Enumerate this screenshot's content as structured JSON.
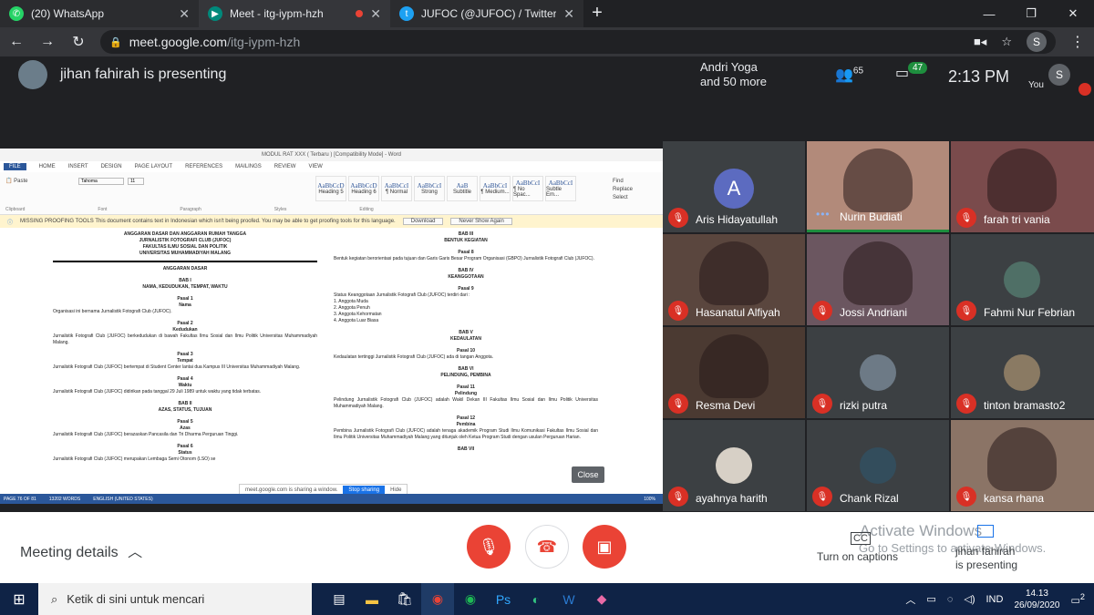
{
  "browser": {
    "tabs": [
      {
        "title": "(20) WhatsApp",
        "icon": "whatsapp-icon",
        "color": "#25d366"
      },
      {
        "title": "Meet - itg-iypm-hzh",
        "icon": "meet-icon",
        "color": "#00897b"
      },
      {
        "title": "JUFOC (@JUFOC) / Twitter",
        "icon": "twitter-icon",
        "color": "#1da1f2"
      }
    ],
    "url_host": "meet.google.com",
    "url_path": "/itg-iypm-hzh",
    "profile_initial": "S"
  },
  "meet": {
    "presenting_text": "jihan fahirah is presenting",
    "others_line1": "Andri Yoga",
    "others_line2": "and 50 more",
    "people_count": "65",
    "chat_count": "47",
    "time": "2:13 PM",
    "you_label": "You",
    "you_initial": "S"
  },
  "word": {
    "title": "MODUL RAT XXX ( Terbaru ) [Compatibility Mode] - Word",
    "ribbon_tabs": [
      "FILE",
      "HOME",
      "INSERT",
      "DESIGN",
      "PAGE LAYOUT",
      "REFERENCES",
      "MAILINGS",
      "REVIEW",
      "VIEW"
    ],
    "styles": [
      {
        "preview": "AaBbCcD",
        "name": "Heading 5"
      },
      {
        "preview": "AaBbCcD",
        "name": "Heading 6"
      },
      {
        "preview": "AaBbCcI",
        "name": "¶ Normal"
      },
      {
        "preview": "AaBbCcI",
        "name": "Strong"
      },
      {
        "preview": "AaB",
        "name": "Subtitle"
      },
      {
        "preview": "AaBbCcI",
        "name": "¶ Medium..."
      },
      {
        "preview": "AaBbCcI",
        "name": "¶ No Spac..."
      },
      {
        "preview": "AaBbCcI",
        "name": "Subtle Em..."
      }
    ],
    "ribbon_groups": [
      "Clipboard",
      "Font",
      "Paragraph",
      "Styles",
      "Editing"
    ],
    "proofing_msg": "MISSING PROOFING TOOLS   This document contains text in Indonesian which isn't being proofed. You may be able to get proofing tools for this language.",
    "proofing_download": "Download",
    "proofing_never": "Never Show Again",
    "col1": [
      {
        "t": "h",
        "v": "ANGGARAN DASAR DAN ANGGARAN RUMAH TANGGA"
      },
      {
        "t": "h",
        "v": "JURNALISTIK FOTOGRAFI CLUB (JUFOC)"
      },
      {
        "t": "h",
        "v": "FAKULTAS ILMU SOSIAL DAN POLITIK"
      },
      {
        "t": "h",
        "v": "UNIVERSITAS MUHAMMADIYAH MALANG"
      },
      {
        "t": "hr",
        "v": ""
      },
      {
        "t": "h",
        "v": "ANGGARAN DASAR"
      },
      {
        "t": "s",
        "v": ""
      },
      {
        "t": "h",
        "v": "BAB I"
      },
      {
        "t": "h",
        "v": "NAMA, KEDUDUKAN, TEMPAT, WAKTU"
      },
      {
        "t": "s",
        "v": ""
      },
      {
        "t": "h",
        "v": "Pasal 1"
      },
      {
        "t": "h",
        "v": "Nama"
      },
      {
        "t": "p",
        "v": "Organisasi ini bernama Jurnalistik Fotografi Club (JUFOC)."
      },
      {
        "t": "s",
        "v": ""
      },
      {
        "t": "h",
        "v": "Pasal 2"
      },
      {
        "t": "h",
        "v": "Kedudukan"
      },
      {
        "t": "p",
        "v": "Jurnalistik Fotografi Club (JUFOC) berkedudukan di bawah Fakultas Ilmu Sosial dan Ilmu Politik Universitas Muhammadiyah Malang."
      },
      {
        "t": "s",
        "v": ""
      },
      {
        "t": "h",
        "v": "Pasal 3"
      },
      {
        "t": "h",
        "v": "Tempat"
      },
      {
        "t": "p",
        "v": "Jurnalistik Fotografi Club (JUFOC) bertempat di Student Center lantai dua Kampus III Universitas Muhammadiyah Malang."
      },
      {
        "t": "s",
        "v": ""
      },
      {
        "t": "h",
        "v": "Pasal 4"
      },
      {
        "t": "h",
        "v": "Waktu"
      },
      {
        "t": "p",
        "v": "Jurnalistik Fotografi Club (JUFOC) didirikan pada tanggal 29 Juli 1989 untuk waktu yang tidak terbatas."
      },
      {
        "t": "s",
        "v": ""
      },
      {
        "t": "h",
        "v": "BAB II"
      },
      {
        "t": "h",
        "v": "AZAS, STATUS, TUJUAN"
      },
      {
        "t": "s",
        "v": ""
      },
      {
        "t": "h",
        "v": "Pasal 5"
      },
      {
        "t": "h",
        "v": "Azas"
      },
      {
        "t": "p",
        "v": "Jurnalistik Fotografi Club (JUFOC) berazaskan Pancasila dan Tri Dharma Perguruan Tinggi."
      },
      {
        "t": "s",
        "v": ""
      },
      {
        "t": "h",
        "v": "Pasal 6"
      },
      {
        "t": "h",
        "v": "Status"
      },
      {
        "t": "p",
        "v": "Jurnalistik Fotografi Club (JUFOC) merupakan Lembaga Semi Otonom (LSO) se"
      }
    ],
    "col2": [
      {
        "t": "h",
        "v": "BAB III"
      },
      {
        "t": "h",
        "v": "BENTUK KEGIATAN"
      },
      {
        "t": "s",
        "v": ""
      },
      {
        "t": "h",
        "v": "Pasal 8"
      },
      {
        "t": "p",
        "v": "Bentuk kegiatan berorientasi pada tujuan dan Garis Garis Besar Program Organisasi (GBPO) Jurnalistik Fotografi Club (JUFOC)."
      },
      {
        "t": "s",
        "v": ""
      },
      {
        "t": "h",
        "v": "BAB IV"
      },
      {
        "t": "h",
        "v": "KEANGGOTAAN"
      },
      {
        "t": "s",
        "v": ""
      },
      {
        "t": "h",
        "v": "Pasal 9"
      },
      {
        "t": "p",
        "v": "Status Keanggotaan Jurnalistik Fotografi Club (JUFOC) terdiri dari :"
      },
      {
        "t": "p",
        "v": "1.    Anggota Muda"
      },
      {
        "t": "p",
        "v": "2.    Anggota Penuh"
      },
      {
        "t": "p",
        "v": "3.    Anggota Kehormatan"
      },
      {
        "t": "p",
        "v": "4.    Anggota Luar Biasa"
      },
      {
        "t": "s",
        "v": ""
      },
      {
        "t": "h",
        "v": "BAB V"
      },
      {
        "t": "h",
        "v": "KEDAULATAN"
      },
      {
        "t": "s",
        "v": ""
      },
      {
        "t": "h",
        "v": "Pasal 10"
      },
      {
        "t": "p",
        "v": "Kedaulatan tertinggi Jurnalistik Fotografi Club (JUFOC) ada di tangan Anggota."
      },
      {
        "t": "s",
        "v": ""
      },
      {
        "t": "h",
        "v": "BAB VI"
      },
      {
        "t": "h",
        "v": "PELINDUNG, PEMBINA"
      },
      {
        "t": "s",
        "v": ""
      },
      {
        "t": "h",
        "v": "Pasal 11"
      },
      {
        "t": "h",
        "v": "Pelindung"
      },
      {
        "t": "p",
        "v": "Pelindung Jurnalistik Fotografi Club (JUFOC) adalah Wakil Dekan III Fakultas Ilmu Sosial dan Ilmu Politik Universitas Muhammadiyah Malang."
      },
      {
        "t": "s",
        "v": ""
      },
      {
        "t": "h",
        "v": "Pasal 12"
      },
      {
        "t": "h",
        "v": "Pembina"
      },
      {
        "t": "p",
        "v": "Pembina Jurnalistik Fotografi Club (JUFOC) adalah tenaga akademik Program Studi Ilmu Komunikasi Fakultas Ilmu Sosial dan Ilmu Politik Universitas Muhammadiyah Malang yang ditunjuk oleh Ketua Program Studi dengan usulan Perguruan Harian."
      },
      {
        "t": "s",
        "v": ""
      },
      {
        "t": "h",
        "v": "BAB VII"
      }
    ],
    "status_items": [
      "PAGE 76 OF 81",
      "13202 WORDS",
      "ENGLISH (UNITED STATES)"
    ],
    "zoom": "100%",
    "share_text": "meet.google.com is sharing a window.",
    "stop_sharing": "Stop sharing",
    "hide": "Hide",
    "close": "Close"
  },
  "participants": [
    {
      "name": "Aris Hidayatullah",
      "initial": "A",
      "muted": true,
      "bg": "#3c4043"
    },
    {
      "name": "Nurin Budiati",
      "muted": false,
      "bg": "#b28a7a",
      "speaking": true
    },
    {
      "name": "farah tri vania",
      "muted": true,
      "bg": "#7a4b4c"
    },
    {
      "name": "Hasanatul Alfiyah",
      "muted": true,
      "bg": "#5a463e"
    },
    {
      "name": "Jossi Andriani",
      "muted": true,
      "bg": "#6b5660"
    },
    {
      "name": "Fahmi Nur Febrian",
      "muted": true,
      "bg": "#3c4043",
      "avatar": "#4f6f66"
    },
    {
      "name": "Resma Devi",
      "muted": true,
      "bg": "#4b3a32"
    },
    {
      "name": "rizki putra",
      "muted": true,
      "bg": "#3c4043",
      "avatar": "#6d7a86"
    },
    {
      "name": "tinton bramasto2",
      "muted": true,
      "bg": "#3c4043",
      "avatar": "#8a7a63"
    },
    {
      "name": "ayahnya harith",
      "muted": true,
      "bg": "#3c4043",
      "avatar": "#d7d0c6"
    },
    {
      "name": "Chank Rizal",
      "muted": true,
      "bg": "#3c4043",
      "avatar": "#334d5c"
    },
    {
      "name": "kansa rhana",
      "muted": true,
      "bg": "#8b7466"
    }
  ],
  "controls": {
    "meeting_details": "Meeting details",
    "captions": "Turn on captions",
    "presenting_line1": "jihan fahirah",
    "presenting_line2": "is presenting",
    "watermark1": "Activate Windows",
    "watermark2": "Go to Settings to activate Windows.",
    "red": "#ea4335"
  },
  "taskbar": {
    "search_placeholder": "Ketik di sini untuk mencari",
    "lang": "IND",
    "time": "14.13",
    "date": "26/09/2020",
    "notif": "2"
  }
}
